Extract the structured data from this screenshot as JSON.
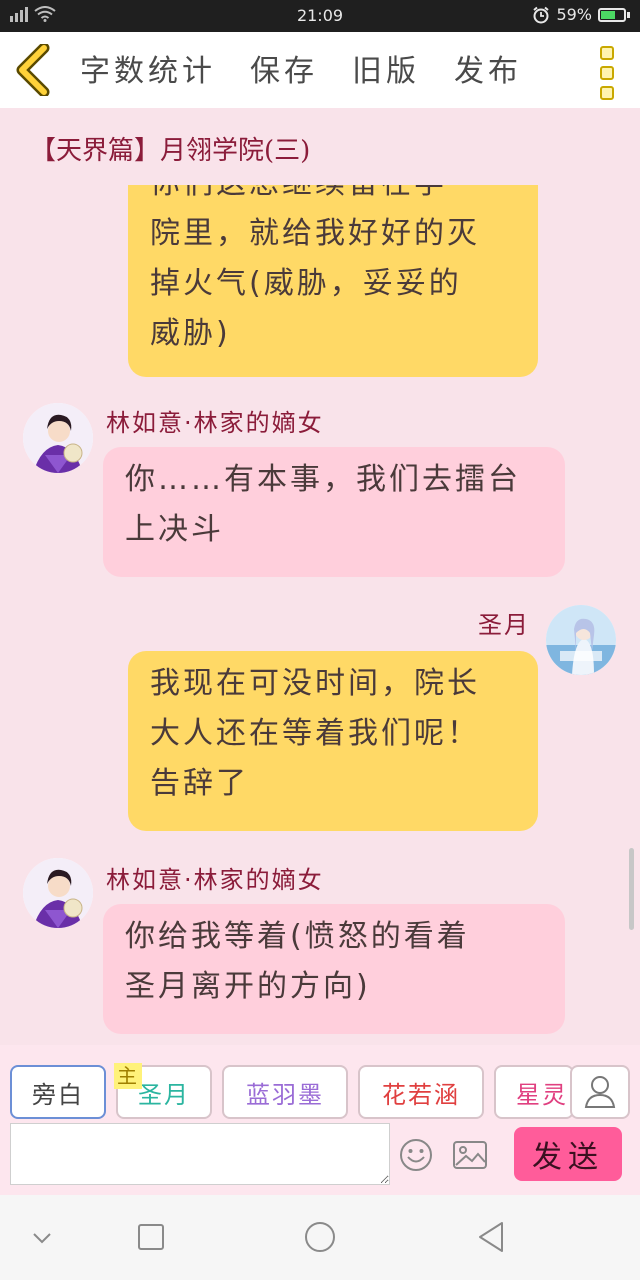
{
  "status_bar": {
    "time": "21:09",
    "battery": "59%"
  },
  "toolbar": {
    "back_icon": "chevron-left-icon",
    "items": [
      "字数统计",
      "保存",
      "旧版",
      "发布"
    ],
    "more_icon": "more-vertical-icon"
  },
  "story": {
    "title": "【天界篇】月翎学院(三)"
  },
  "messages": [
    {
      "side": "me",
      "lines": [
        "你们这想继续留在学",
        "院里，就给我好好的灭",
        "掉火气(威胁，妥妥的",
        "威胁)"
      ]
    },
    {
      "side": "other",
      "name": "林如意·林家的嫡女",
      "lines": [
        "你……有本事，我们去擂台",
        "上决斗"
      ]
    },
    {
      "side": "me",
      "name": "圣月",
      "lines": [
        "我现在可没时间，院长",
        "大人还在等着我们呢！",
        "告辞了"
      ]
    },
    {
      "side": "other",
      "name": "林如意·林家的嫡女",
      "lines": [
        "你给我等着(愤怒的看着",
        "圣月离开的方向)"
      ]
    }
  ],
  "input": {
    "roles": [
      {
        "label": "旁白",
        "color": "#444444"
      },
      {
        "label": "圣月",
        "color": "#2bb5a0",
        "badge": "主"
      },
      {
        "label": "蓝羽墨",
        "color": "#9a6cd6"
      },
      {
        "label": "花若涵",
        "color": "#e04040"
      },
      {
        "label": "星灵",
        "color": "#e04080"
      }
    ],
    "message_value": "",
    "send_label": "发送"
  },
  "colors": {
    "my_bubble": "#ffd966",
    "other_bubble": "#ffcfdc",
    "send": "#ff5c9a",
    "name": "#8b1c3a"
  }
}
